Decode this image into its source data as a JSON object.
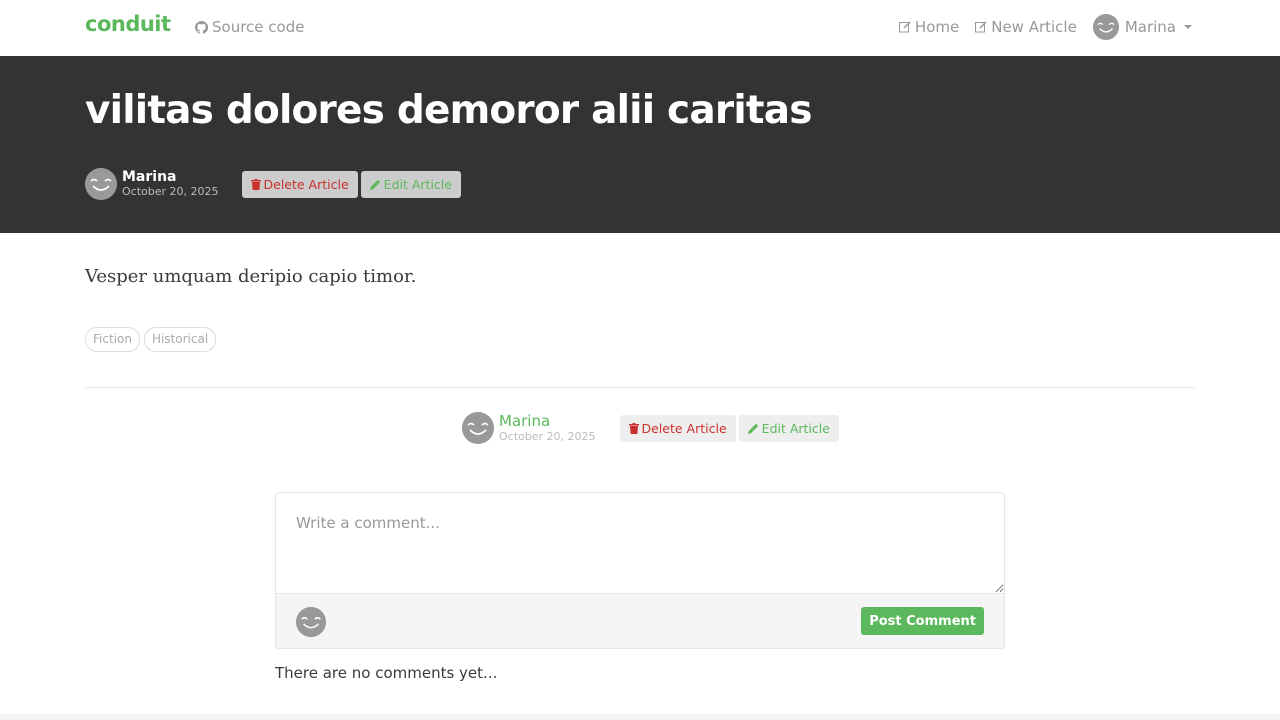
{
  "navbar": {
    "brand": "conduit",
    "source_code": "Source code",
    "home": "Home",
    "new_article": "New Article",
    "user": "Marina"
  },
  "article": {
    "title": "vilitas dolores demoror alii caritas",
    "author": "Marina",
    "date": "October 20, 2025",
    "body": "Vesper umquam deripio capio timor.",
    "tags": [
      "Fiction",
      "Historical"
    ],
    "delete_label": "Delete Article",
    "edit_label": "Edit Article"
  },
  "comments": {
    "placeholder": "Write a comment...",
    "post_label": "Post Comment",
    "empty_text": "There are no comments yet..."
  },
  "colors": {
    "brand": "#5cb85c",
    "banner": "#333333",
    "danger": "#c9302c"
  },
  "icons": [
    "github-icon",
    "edit-icon",
    "trash-icon",
    "pencil-icon",
    "avatar-icon",
    "caret-down-icon"
  ]
}
